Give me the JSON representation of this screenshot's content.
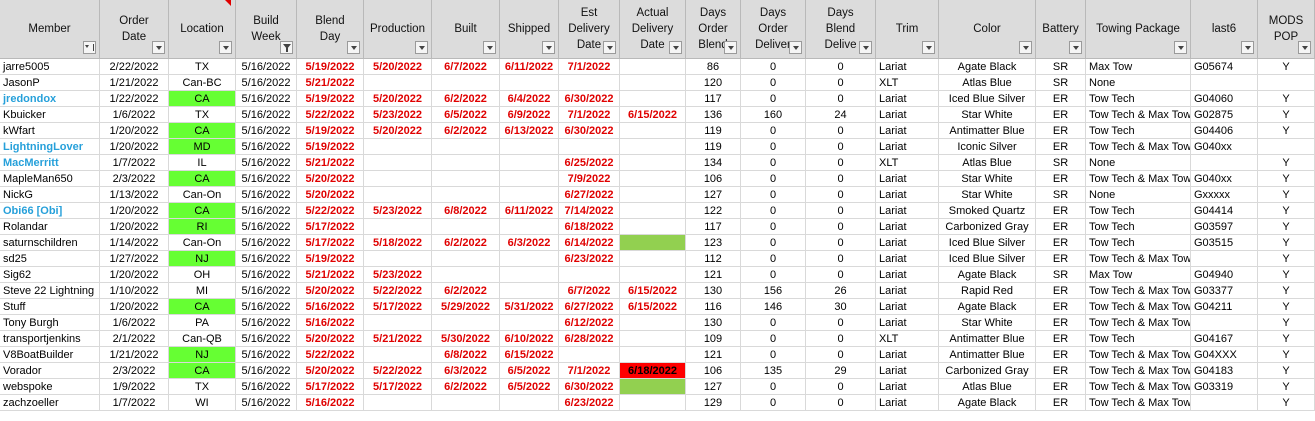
{
  "headers": [
    "Member",
    "Order\nDate",
    "Location",
    "Build\nWeek",
    "Blend\nDay",
    "Production",
    "Built",
    "Shipped",
    "Est\nDelivery\nDate",
    "Actual\nDelivery\nDate",
    "Days\nOrder\nBlend",
    "Days\nOrder\nDeliver",
    "Days\nBlend\nDelive",
    "Trim",
    "Color",
    "Battery",
    "Towing Package",
    "last6",
    "MODS\nPOP"
  ],
  "rows": [
    [
      "jarre5005",
      "2/22/2022",
      "TX",
      "5/16/2022",
      "5/19/2022",
      "5/20/2022",
      "6/7/2022",
      "6/11/2022",
      "7/1/2022",
      "",
      "86",
      "0",
      "0",
      "Lariat",
      "Agate Black",
      "SR",
      "Max Tow",
      "G05674",
      "Y"
    ],
    [
      "JasonP",
      "1/21/2022",
      "Can-BC",
      "5/16/2022",
      "5/21/2022",
      "",
      "",
      "",
      "",
      "",
      "120",
      "0",
      "0",
      "XLT",
      "Atlas Blue",
      "SR",
      "None",
      "",
      ""
    ],
    [
      "jredondox",
      "1/22/2022",
      "CA",
      "5/16/2022",
      "5/19/2022",
      "5/20/2022",
      "6/2/2022",
      "6/4/2022",
      "6/30/2022",
      "",
      "117",
      "0",
      "0",
      "Lariat",
      "Iced Blue Silver",
      "ER",
      "Tow Tech",
      "G04060",
      "Y"
    ],
    [
      "Kbuicker",
      "1/6/2022",
      "TX",
      "5/16/2022",
      "5/22/2022",
      "5/23/2022",
      "6/5/2022",
      "6/9/2022",
      "7/1/2022",
      "6/15/2022",
      "136",
      "160",
      "24",
      "Lariat",
      "Star White",
      "ER",
      "Tow Tech & Max Tow",
      "G02875",
      "Y"
    ],
    [
      "kWfart",
      "1/20/2022",
      "CA",
      "5/16/2022",
      "5/19/2022",
      "5/20/2022",
      "6/2/2022",
      "6/13/2022",
      "6/30/2022",
      "",
      "119",
      "0",
      "0",
      "Lariat",
      "Antimatter Blue",
      "ER",
      "Tow Tech",
      "G04406",
      "Y"
    ],
    [
      "LightningLover",
      "1/20/2022",
      "MD",
      "5/16/2022",
      "5/19/2022",
      "",
      "",
      "",
      "",
      "",
      "119",
      "0",
      "0",
      "Lariat",
      "Iconic Silver",
      "ER",
      "Tow Tech & Max Tow",
      "G040xx",
      ""
    ],
    [
      "MacMerritt",
      "1/7/2022",
      "IL",
      "5/16/2022",
      "5/21/2022",
      "",
      "",
      "",
      "6/25/2022",
      "",
      "134",
      "0",
      "0",
      "XLT",
      "Atlas Blue",
      "SR",
      "None",
      "",
      "Y"
    ],
    [
      "MapleMan650",
      "2/3/2022",
      "CA",
      "5/16/2022",
      "5/20/2022",
      "",
      "",
      "",
      "7/9/2022",
      "",
      "106",
      "0",
      "0",
      "Lariat",
      "Star White",
      "ER",
      "Tow Tech & Max Tow",
      "G040xx",
      "Y"
    ],
    [
      "NickG",
      "1/13/2022",
      "Can-On",
      "5/16/2022",
      "5/20/2022",
      "",
      "",
      "",
      "6/27/2022",
      "",
      "127",
      "0",
      "0",
      "Lariat",
      "Star White",
      "SR",
      "None",
      "Gxxxxx",
      "Y"
    ],
    [
      "Obi66 [Obi]",
      "1/20/2022",
      "CA",
      "5/16/2022",
      "5/22/2022",
      "5/23/2022",
      "6/8/2022",
      "6/11/2022",
      "7/14/2022",
      "",
      "122",
      "0",
      "0",
      "Lariat",
      "Smoked Quartz",
      "ER",
      "Tow Tech",
      "G04414",
      "Y"
    ],
    [
      "Rolandar",
      "1/20/2022",
      "RI",
      "5/16/2022",
      "5/17/2022",
      "",
      "",
      "",
      "6/18/2022",
      "",
      "117",
      "0",
      "0",
      "Lariat",
      "Carbonized Gray",
      "ER",
      "Tow Tech",
      "G03597",
      "Y"
    ],
    [
      "saturnschildren",
      "1/14/2022",
      "Can-On",
      "5/16/2022",
      "5/17/2022",
      "5/18/2022",
      "6/2/2022",
      "6/3/2022",
      "6/14/2022",
      "",
      "123",
      "0",
      "0",
      "Lariat",
      "Iced Blue Silver",
      "ER",
      "Tow Tech",
      "G03515",
      "Y"
    ],
    [
      "sd25",
      "1/27/2022",
      "NJ",
      "5/16/2022",
      "5/19/2022",
      "",
      "",
      "",
      "6/23/2022",
      "",
      "112",
      "0",
      "0",
      "Lariat",
      "Iced Blue Silver",
      "ER",
      "Tow Tech & Max Tow",
      "",
      "Y"
    ],
    [
      "Sig62",
      "1/20/2022",
      "OH",
      "5/16/2022",
      "5/21/2022",
      "5/23/2022",
      "",
      "",
      "",
      "",
      "121",
      "0",
      "0",
      "Lariat",
      "Agate Black",
      "SR",
      "Max Tow",
      "G04940",
      "Y"
    ],
    [
      "Steve 22 Lightning",
      "1/10/2022",
      "MI",
      "5/16/2022",
      "5/20/2022",
      "5/22/2022",
      "6/2/2022",
      "",
      "6/7/2022",
      "6/15/2022",
      "130",
      "156",
      "26",
      "Lariat",
      "Rapid Red",
      "ER",
      "Tow Tech & Max Tow",
      "G03377",
      "Y"
    ],
    [
      "Stuff",
      "1/20/2022",
      "CA",
      "5/16/2022",
      "5/16/2022",
      "5/17/2022",
      "5/29/2022",
      "5/31/2022",
      "6/27/2022",
      "6/15/2022",
      "116",
      "146",
      "30",
      "Lariat",
      "Agate Black",
      "ER",
      "Tow Tech & Max Tow",
      "G04211",
      "Y"
    ],
    [
      "Tony Burgh",
      "1/6/2022",
      "PA",
      "5/16/2022",
      "5/16/2022",
      "",
      "",
      "",
      "6/12/2022",
      "",
      "130",
      "0",
      "0",
      "Lariat",
      "Star White",
      "ER",
      "Tow Tech & Max Tow",
      "",
      "Y"
    ],
    [
      "transportjenkins",
      "2/1/2022",
      "Can-QB",
      "5/16/2022",
      "5/20/2022",
      "5/21/2022",
      "5/30/2022",
      "6/10/2022",
      "6/28/2022",
      "",
      "109",
      "0",
      "0",
      "XLT",
      "Antimatter Blue",
      "ER",
      "Tow Tech",
      "G04167",
      "Y"
    ],
    [
      "V8BoatBuilder",
      "1/21/2022",
      "NJ",
      "5/16/2022",
      "5/22/2022",
      "",
      "6/8/2022",
      "6/15/2022",
      "",
      "",
      "121",
      "0",
      "0",
      "Lariat",
      "Antimatter Blue",
      "ER",
      "Tow Tech & Max Tow",
      "G04XXX",
      "Y"
    ],
    [
      "Vorador",
      "2/3/2022",
      "CA",
      "5/16/2022",
      "5/20/2022",
      "5/22/2022",
      "6/3/2022",
      "6/5/2022",
      "7/1/2022",
      "6/18/2022",
      "106",
      "135",
      "29",
      "Lariat",
      "Carbonized Gray",
      "ER",
      "Tow Tech & Max Tow",
      "G04183",
      "Y"
    ],
    [
      "webspoke",
      "1/9/2022",
      "TX",
      "5/16/2022",
      "5/17/2022",
      "5/17/2022",
      "6/2/2022",
      "6/5/2022",
      "6/30/2022",
      "",
      "127",
      "0",
      "0",
      "Lariat",
      "Atlas Blue",
      "ER",
      "Tow Tech & Max Tow",
      "G03319",
      "Y"
    ],
    [
      "zachzoeller",
      "1/7/2022",
      "WI",
      "5/16/2022",
      "5/16/2022",
      "",
      "",
      "",
      "6/23/2022",
      "",
      "129",
      "0",
      "0",
      "Lariat",
      "Agate Black",
      "ER",
      "Tow Tech & Max Tow",
      "",
      "Y"
    ]
  ],
  "colors": {
    "header_bg": "#dcdcdc",
    "red_text": "#e00000",
    "blue_member": "#26a0da",
    "green_location": "#66ff33",
    "olive_fill": "#92d050",
    "red_fill": "#ff0000"
  },
  "filter_icons": {
    "member": "sort-icon",
    "build_week": "filter-active-icon",
    "default": "dropdown-arrow-icon"
  }
}
